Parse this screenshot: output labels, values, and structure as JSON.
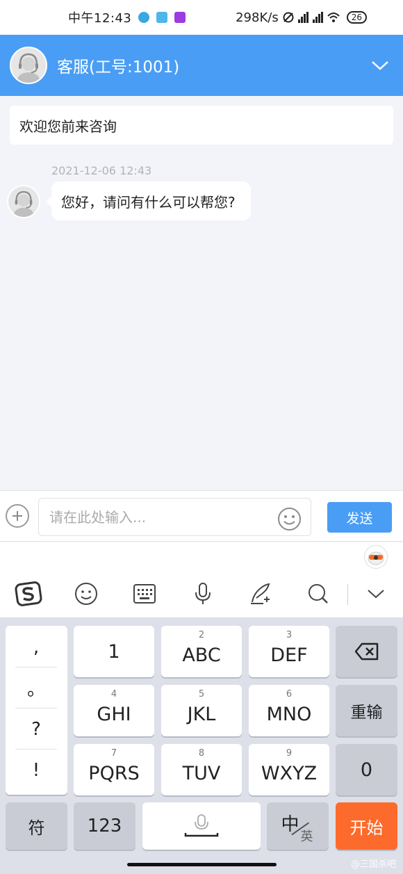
{
  "status_bar": {
    "time": "中午12:43",
    "net_speed": "298K/s",
    "battery": "26"
  },
  "header": {
    "title": "客服(工号:1001)"
  },
  "welcome": {
    "text": "欢迎您前来咨询"
  },
  "message": {
    "timestamp": "2021-12-06 12:43",
    "text": "您好，请问有什么可以帮您?"
  },
  "input_bar": {
    "placeholder": "请在此处输入...",
    "send_label": "发送"
  },
  "keyboard": {
    "punctuation": [
      ",",
      "。",
      "?",
      "!"
    ],
    "row1": [
      {
        "main": "1",
        "sub": ""
      },
      {
        "main": "ABC",
        "sub": "2"
      },
      {
        "main": "DEF",
        "sub": "3"
      }
    ],
    "row2": [
      {
        "main": "GHI",
        "sub": "4"
      },
      {
        "main": "JKL",
        "sub": "5"
      },
      {
        "main": "MNO",
        "sub": "6"
      }
    ],
    "row3": [
      {
        "main": "PQRS",
        "sub": "7"
      },
      {
        "main": "TUV",
        "sub": "8"
      },
      {
        "main": "WXYZ",
        "sub": "9"
      }
    ],
    "reenter": "重输",
    "zero": "0",
    "symbols": "符",
    "numbers": "123",
    "lang_main": "中",
    "lang_alt": "英",
    "start": "开始"
  },
  "watermark": "@三国杀吧",
  "colors": {
    "header_bg": "#4a9df5",
    "send_bg": "#4a9df5",
    "start_key": "#fd6b2c"
  }
}
